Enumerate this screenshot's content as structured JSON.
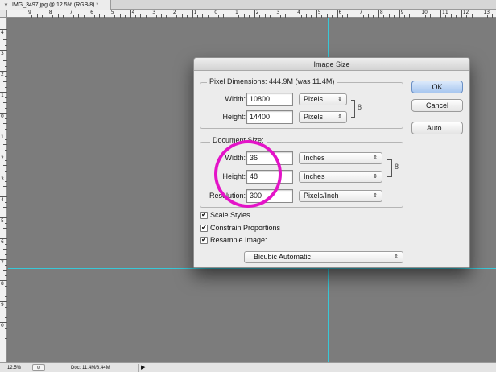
{
  "document": {
    "tab_title": "IMG_3497.jpg @ 12.5% (RGB/8) *",
    "close_glyph": "×"
  },
  "rulers": {
    "top_numbers": [
      "9",
      "8",
      "7",
      "6",
      "5",
      "4",
      "3",
      "2",
      "1",
      "0",
      "1",
      "2",
      "3",
      "4",
      "5",
      "6",
      "7",
      "8",
      "9",
      "10",
      "11",
      "12",
      "13"
    ],
    "left_numbers": [
      "4",
      "3",
      "2",
      "1",
      "0",
      "1",
      "2",
      "3",
      "4",
      "5",
      "6",
      "7",
      "8",
      "9",
      "0"
    ]
  },
  "status_bar": {
    "zoom": "12.5%",
    "doc_info": "Doc: 11.4M/8.44M",
    "arrow": "▶"
  },
  "dialog": {
    "title": "Image Size",
    "pixel_dimensions": {
      "label": "Pixel Dimensions:  444.9M (was 11.4M)",
      "width_label": "Width:",
      "width_value": "10800",
      "width_unit": "Pixels",
      "height_label": "Height:",
      "height_value": "14400",
      "height_unit": "Pixels"
    },
    "document_size": {
      "label": "Document Size:",
      "width_label": "Width:",
      "width_value": "36",
      "width_unit": "Inches",
      "height_label": "Height:",
      "height_value": "48",
      "height_unit": "Inches",
      "resolution_label": "Resolution:",
      "resolution_value": "300",
      "resolution_unit": "Pixels/Inch"
    },
    "buttons": {
      "ok": "OK",
      "cancel": "Cancel",
      "auto": "Auto..."
    },
    "options": {
      "scale_styles": "Scale Styles",
      "constrain_proportions": "Constrain Proportions",
      "resample_image": "Resample Image:",
      "resample_method": "Bicubic Automatic"
    },
    "link_glyph": "8"
  },
  "colors": {
    "guide": "#38c8d8",
    "highlight_circle": "#e414c8",
    "canvas": "#7c7c7c"
  }
}
